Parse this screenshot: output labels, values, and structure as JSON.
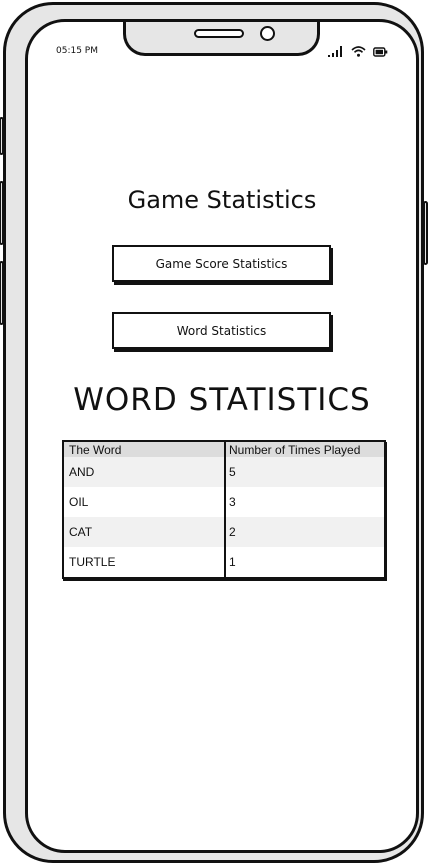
{
  "status_bar": {
    "time": "05:15 PM",
    "icons": [
      "signal-icon",
      "wifi-icon",
      "battery-icon"
    ]
  },
  "page": {
    "title": "Game Statistics",
    "buttons": {
      "game_score": "Game Score Statistics",
      "word_stats": "Word Statistics"
    },
    "section_heading": "WORD STATISTICS"
  },
  "table": {
    "headers": [
      "The Word",
      "Number of Times Played"
    ],
    "rows": [
      [
        "AND",
        "5"
      ],
      [
        "OIL",
        "3"
      ],
      [
        "CAT",
        "2"
      ],
      [
        "TURTLE",
        "1"
      ]
    ]
  }
}
